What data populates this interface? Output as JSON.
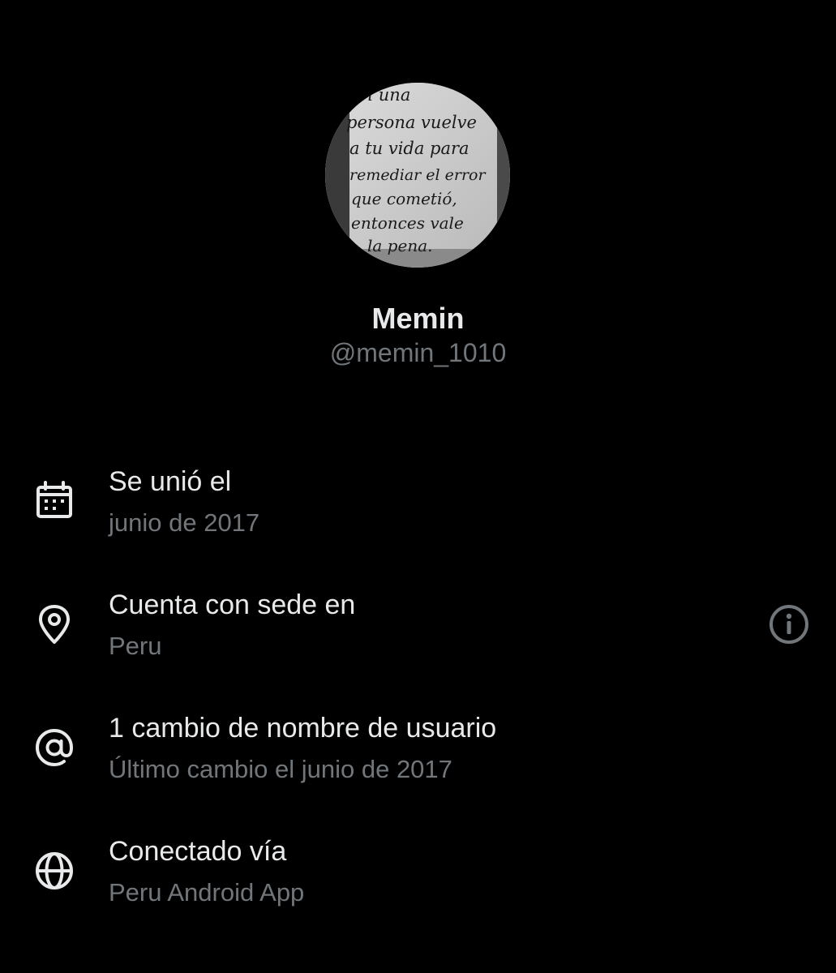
{
  "profile": {
    "avatar_text": [
      "Si una",
      "persona vuelve",
      "a tu vida para",
      "remediar el error",
      "que cometió,",
      "entonces vale",
      "la pena."
    ],
    "display_name": "Memin",
    "handle": "@memin_1010"
  },
  "info": {
    "joined": {
      "title": "Se unió el",
      "value": "junio de 2017",
      "icon": "calendar-icon"
    },
    "location": {
      "title": "Cuenta con sede en",
      "value": "Peru",
      "icon": "location-pin-icon",
      "action_icon": "info-icon"
    },
    "username_changes": {
      "title": "1 cambio de nombre de usuario",
      "value": "Último cambio el junio de 2017",
      "icon": "at-sign-icon"
    },
    "connected": {
      "title": "Conectado vía",
      "value": "Peru Android App",
      "icon": "globe-icon"
    }
  },
  "colors": {
    "background": "#000000",
    "primary_text": "#e7e9ea",
    "secondary_text": "#71767b"
  }
}
